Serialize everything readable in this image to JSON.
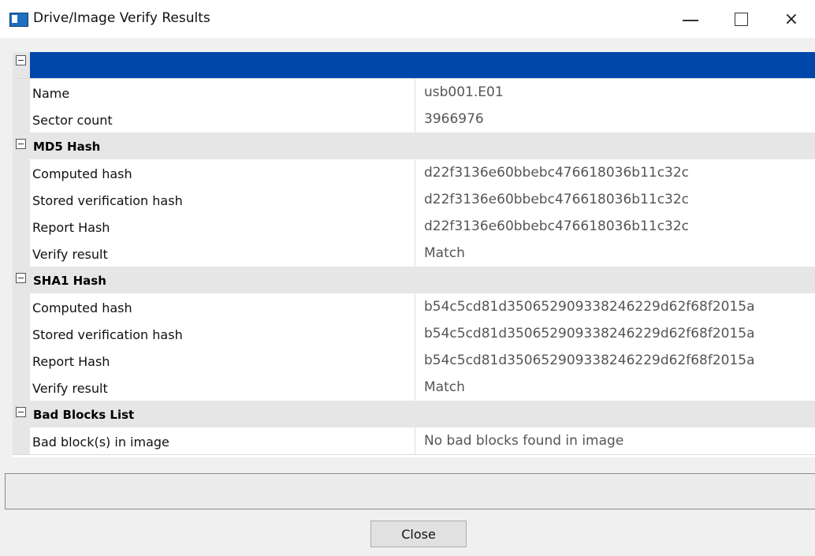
{
  "window": {
    "title": "Drive/Image Verify Results",
    "minimize_icon": "minimize-icon",
    "maximize_icon": "maximize-icon",
    "close_icon": "close-icon",
    "close_glyph": "×"
  },
  "grid": {
    "top_row_label": "",
    "name_label": "Name",
    "name_value": "usb001.E01",
    "sector_label": "Sector count",
    "sector_value": "3966976",
    "md5": {
      "category": "MD5 Hash",
      "computed_label": "Computed hash",
      "computed_value": "d22f3136e60bbebc476618036b11c32c",
      "stored_label": "Stored verification hash",
      "stored_value": "d22f3136e60bbebc476618036b11c32c",
      "report_label": "Report Hash",
      "report_value": "d22f3136e60bbebc476618036b11c32c",
      "verify_label": "Verify result",
      "verify_value": "Match"
    },
    "sha1": {
      "category": "SHA1 Hash",
      "computed_label": "Computed hash",
      "computed_value": "b54c5cd81d350652909338246229d62f68f2015a",
      "stored_label": "Stored verification hash",
      "stored_value": "b54c5cd81d350652909338246229d62f68f2015a",
      "report_label": "Report Hash",
      "report_value": "b54c5cd81d350652909338246229d62f68f2015a",
      "verify_label": "Verify result",
      "verify_value": "Match"
    },
    "bad_blocks": {
      "category": "Bad Blocks List",
      "label": "Bad block(s) in image",
      "value": "No bad blocks found in image"
    }
  },
  "status_text": "",
  "buttons": {
    "close": "Close"
  },
  "colors": {
    "selected_row": "#0047ab",
    "category_bg": "#e6e6e6"
  }
}
